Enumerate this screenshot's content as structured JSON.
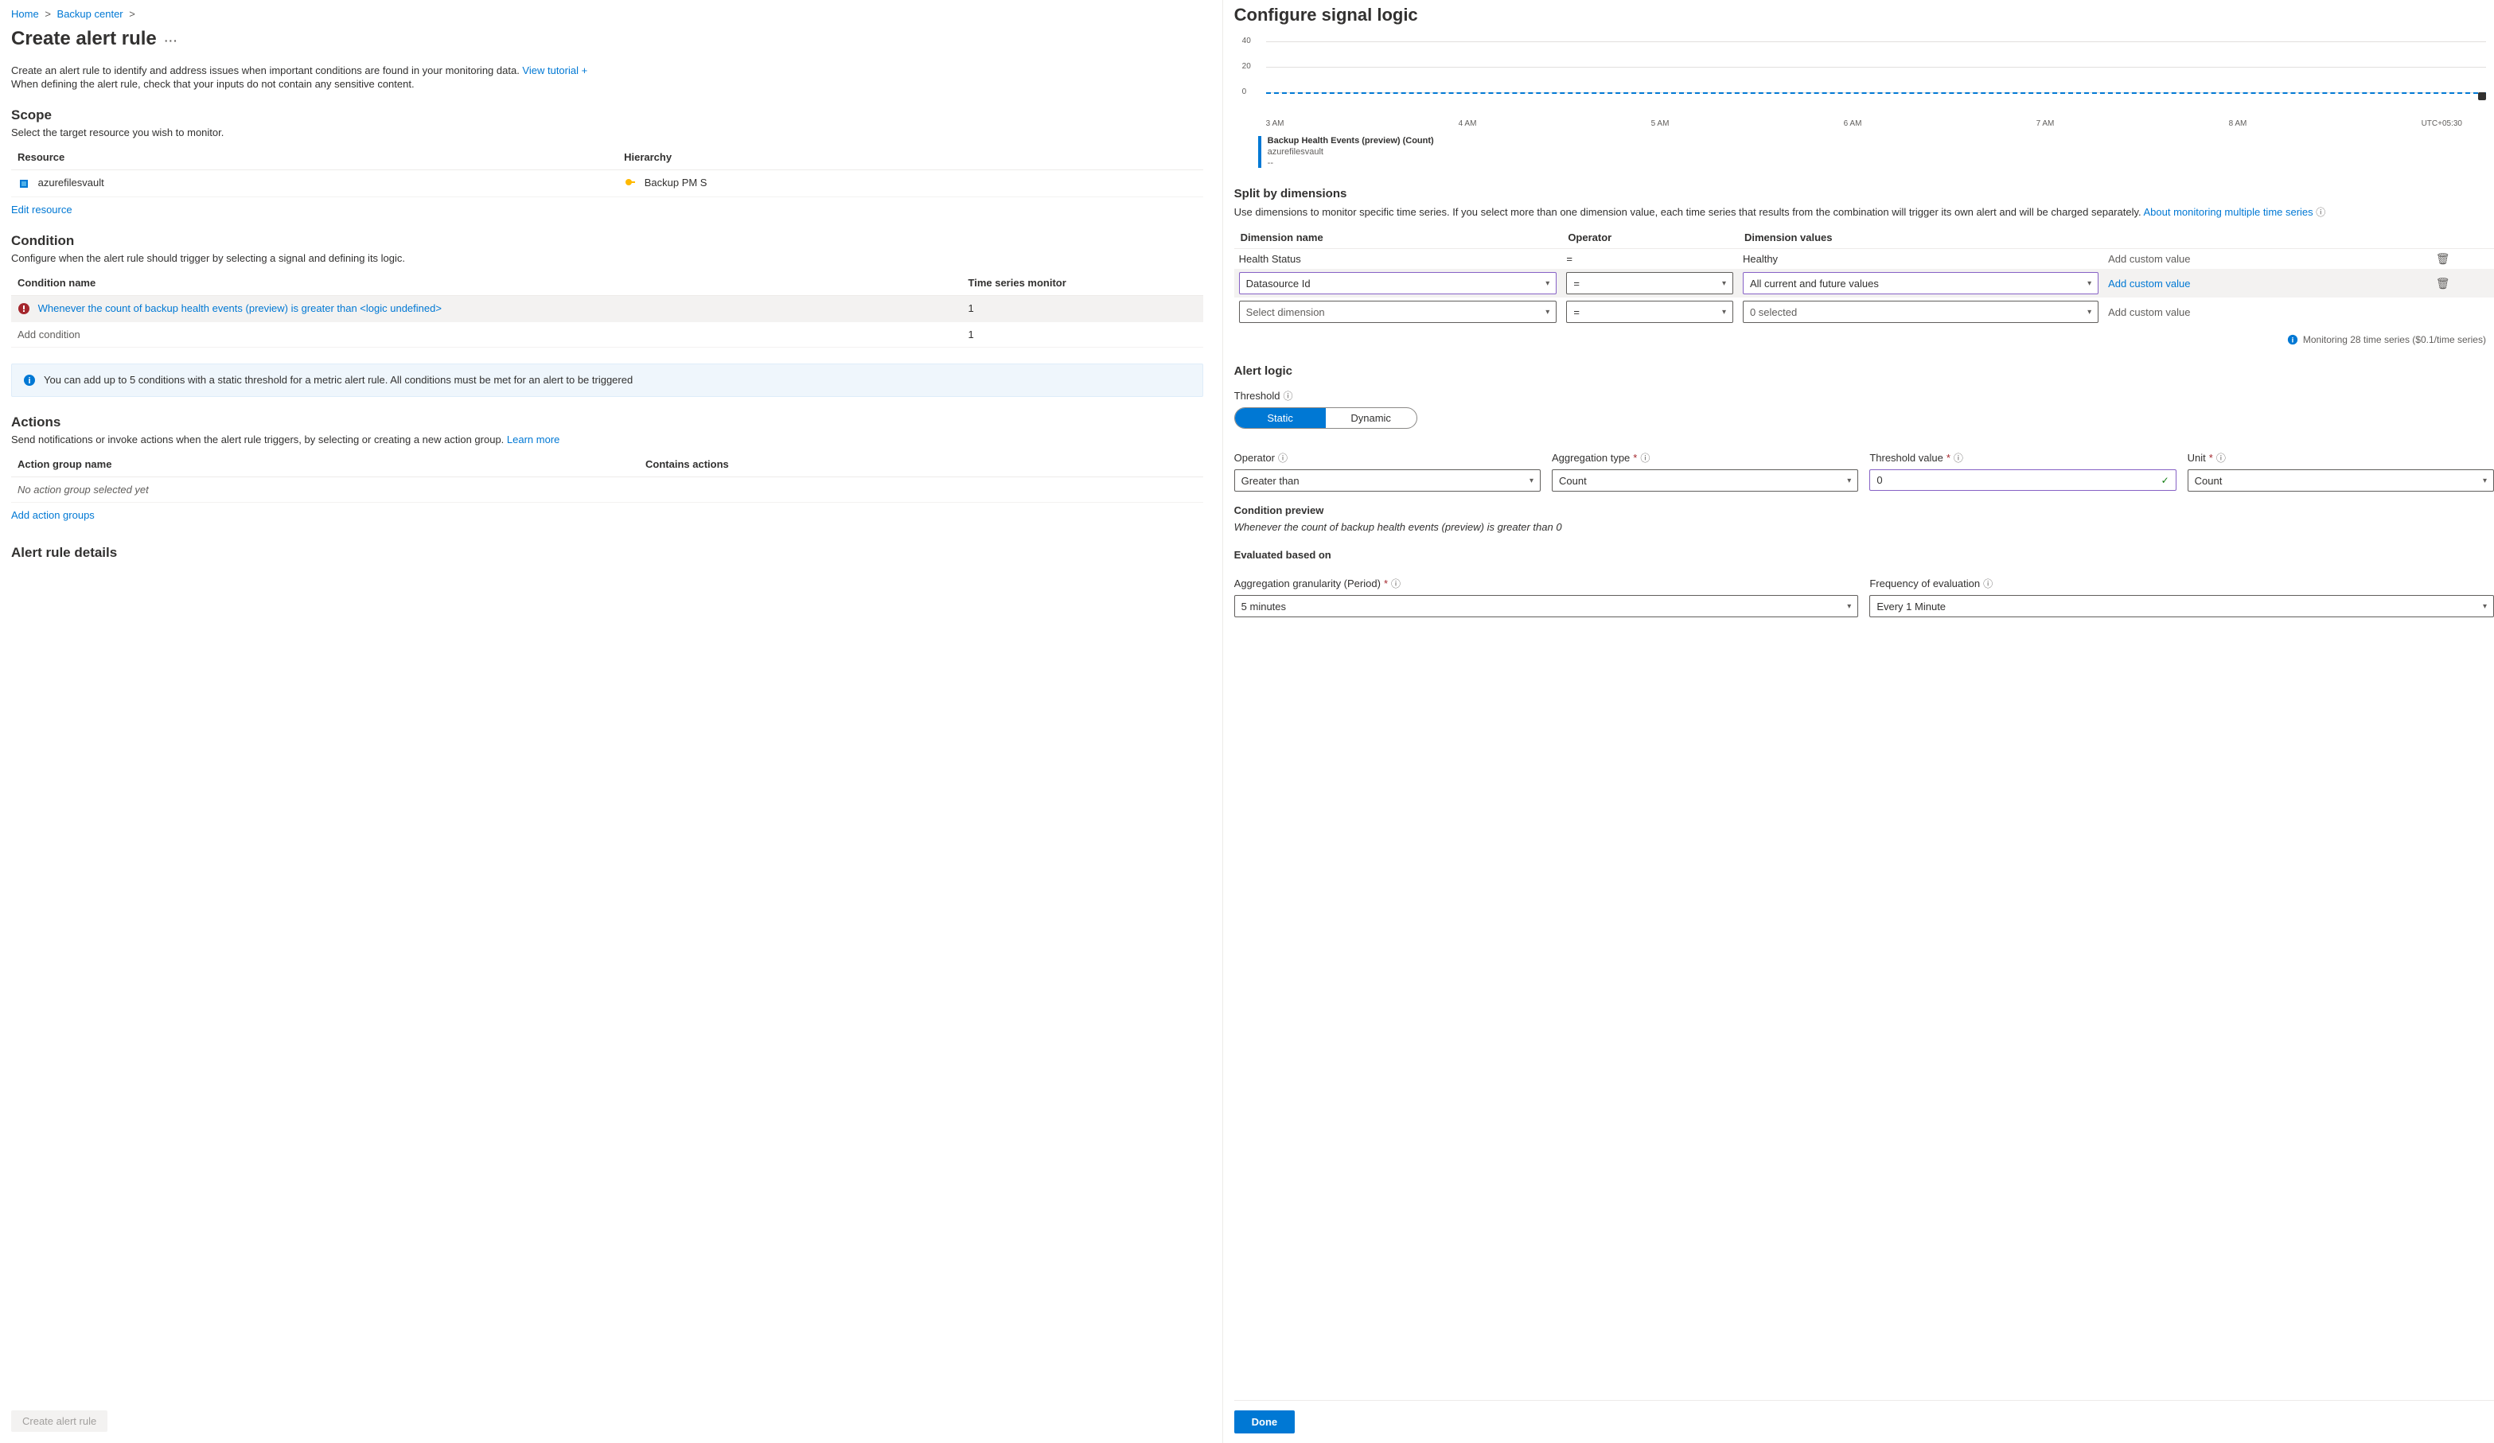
{
  "breadcrumb": {
    "home": "Home",
    "backup_center": "Backup center"
  },
  "page": {
    "title": "Create alert rule"
  },
  "intro": {
    "line1": "Create an alert rule to identify and address issues when important conditions are found in your monitoring data. ",
    "tutorial_link": "View tutorial +",
    "line2": "When defining the alert rule, check that your inputs do not contain any sensitive content."
  },
  "scope": {
    "heading": "Scope",
    "sub": "Select the target resource you wish to monitor.",
    "col_resource": "Resource",
    "col_hierarchy": "Hierarchy",
    "resource_name": "azurefilesvault",
    "hierarchy_value": "Backup PM S",
    "edit_link": "Edit resource"
  },
  "condition": {
    "heading": "Condition",
    "sub": "Configure when the alert rule should trigger by selecting a signal and defining its logic.",
    "col_name": "Condition name",
    "col_ts": "Time series monitor",
    "row_link": "Whenever the count of backup health events (preview) is greater than <logic undefined>",
    "row_ts": "1",
    "add_condition": "Add condition",
    "add_ts": "1",
    "banner": "You can add up to 5 conditions with a static threshold for a metric alert rule. All conditions must be met for an alert to be triggered"
  },
  "actions": {
    "heading": "Actions",
    "sub_pre": "Send notifications or invoke actions when the alert rule triggers, by selecting or creating a new action group. ",
    "learn_more": "Learn more",
    "col_name": "Action group name",
    "col_contains": "Contains actions",
    "none": "No action group selected yet",
    "add_link": "Add action groups"
  },
  "details": {
    "heading": "Alert rule details"
  },
  "create_btn": "Create alert rule",
  "right": {
    "title": "Configure signal logic",
    "chart": {
      "legend_title": "Backup Health Events (preview) (Count)",
      "legend_sub": "azurefilesvault",
      "legend_val": "--"
    },
    "split": {
      "heading": "Split by dimensions",
      "desc_pre": "Use dimensions to monitor specific time series. If you select more than one dimension value, each time series that results from the combination will trigger its own alert and will be charged separately. ",
      "about_link": "About monitoring multiple time series",
      "col_dim": "Dimension name",
      "col_op": "Operator",
      "col_vals": "Dimension values",
      "r1": {
        "dim": "Health Status",
        "op": "=",
        "vals": "Healthy",
        "custom": "Add custom value"
      },
      "r2": {
        "dim": "Datasource Id",
        "op": "=",
        "vals": "All current and future values",
        "custom": "Add custom value"
      },
      "r3": {
        "dim": "Select dimension",
        "op": "=",
        "vals": "0 selected",
        "custom": "Add custom value"
      }
    },
    "monitoring_note": "Monitoring 28 time series ($0.1/time series)",
    "alert_logic": {
      "heading": "Alert logic",
      "threshold_label": "Threshold",
      "static": "Static",
      "dynamic": "Dynamic",
      "operator_label": "Operator",
      "operator_val": "Greater than",
      "agg_label": "Aggregation type",
      "agg_val": "Count",
      "thresh_label": "Threshold value",
      "thresh_val": "0",
      "unit_label": "Unit",
      "unit_val": "Count"
    },
    "preview": {
      "heading": "Condition preview",
      "text": "Whenever the count of backup health events (preview) is greater than 0"
    },
    "eval": {
      "heading": "Evaluated based on",
      "gran_label": "Aggregation granularity (Period)",
      "gran_val": "5 minutes",
      "freq_label": "Frequency of evaluation",
      "freq_val": "Every 1 Minute"
    },
    "done": "Done"
  },
  "chart_data": {
    "type": "line",
    "title": "Backup Health Events (preview) (Count)",
    "x_ticks": [
      "3 AM",
      "4 AM",
      "5 AM",
      "6 AM",
      "7 AM",
      "8 AM",
      "UTC+05:30"
    ],
    "y_ticks": [
      0,
      20,
      40
    ],
    "ylim": [
      0,
      40
    ],
    "series": [
      {
        "name": "azurefilesvault",
        "values": [
          0,
          0,
          0,
          0,
          0,
          0,
          0
        ]
      }
    ]
  }
}
